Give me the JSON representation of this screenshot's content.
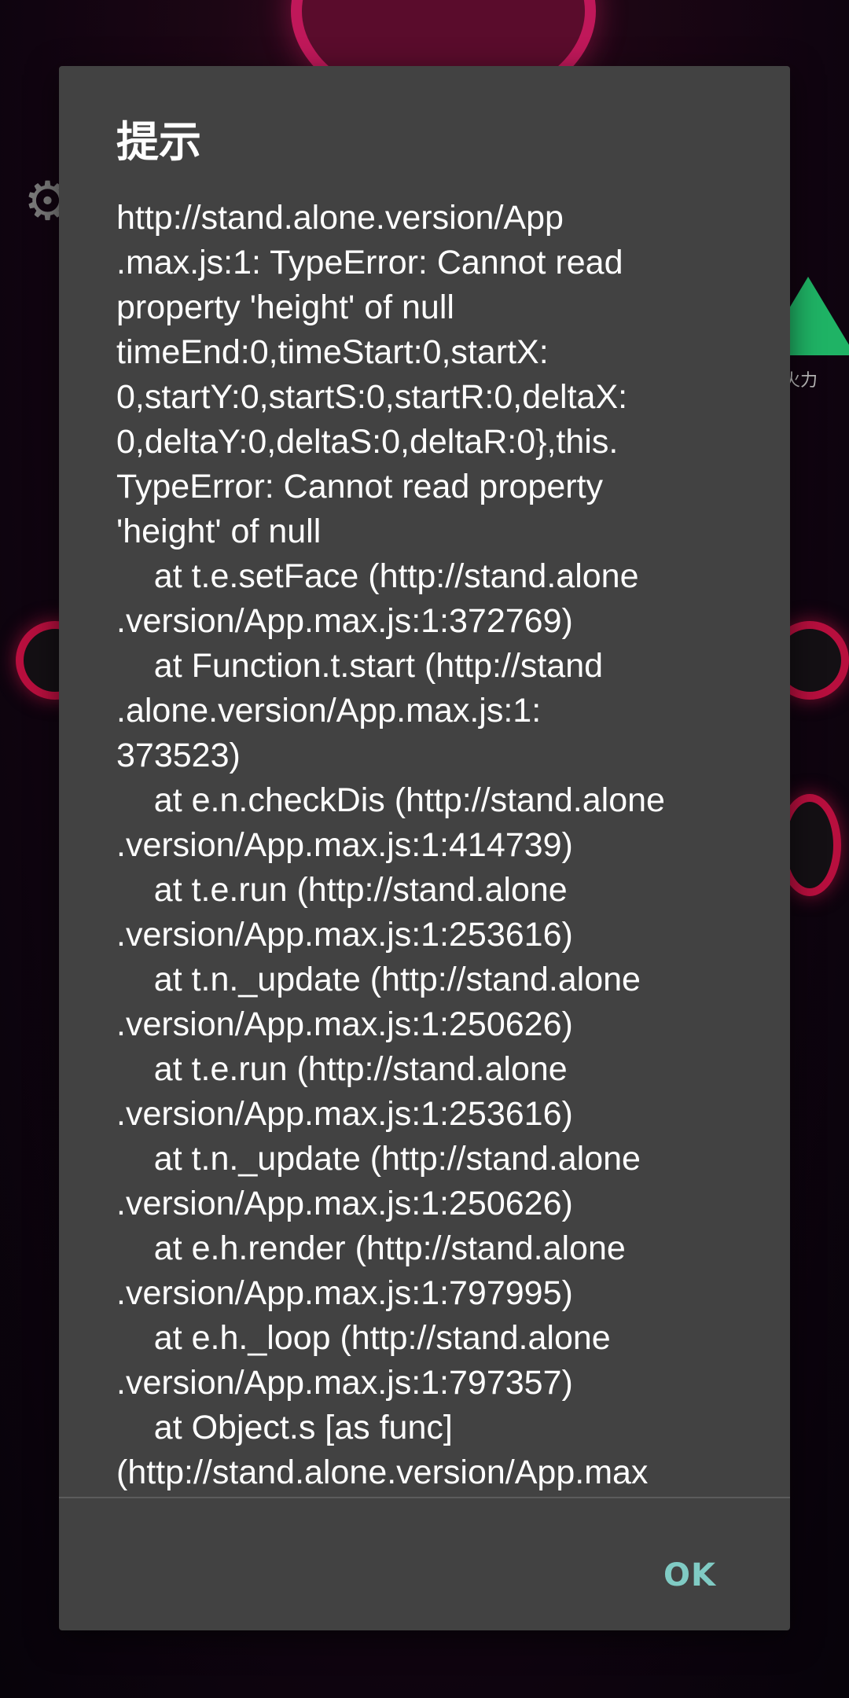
{
  "dialog": {
    "title": "提示",
    "message": "http://stand.alone.version/App\n.max.js:1: TypeError: Cannot read\nproperty 'height' of null\ntimeEnd:0,timeStart:0,startX:\n0,startY:0,startS:0,startR:0,deltaX:\n0,deltaY:0,deltaS:0,deltaR:0},this.\nTypeError: Cannot read property\n'height' of null\n    at t.e.setFace (http://stand.alone\n.version/App.max.js:1:372769)\n    at Function.t.start (http://stand\n.alone.version/App.max.js:1:\n373523)\n    at e.n.checkDis (http://stand.alone\n.version/App.max.js:1:414739)\n    at t.e.run (http://stand.alone\n.version/App.max.js:1:253616)\n    at t.n._update (http://stand.alone\n.version/App.max.js:1:250626)\n    at t.e.run (http://stand.alone\n.version/App.max.js:1:253616)\n    at t.n._update (http://stand.alone\n.version/App.max.js:1:250626)\n    at e.h.render (http://stand.alone\n.version/App.max.js:1:797995)\n    at e.h._loop (http://stand.alone\n.version/App.max.js:1:797357)\n    at Object.s [as func]\n(http://stand.alone.version/App.max",
    "ok_label": "OK"
  },
  "background": {
    "right_label": "火力",
    "settings_icon": "gear-icon"
  },
  "colors": {
    "dialog_bg": "#424242",
    "button_accent": "#80cbc4",
    "text": "#ffffff"
  }
}
